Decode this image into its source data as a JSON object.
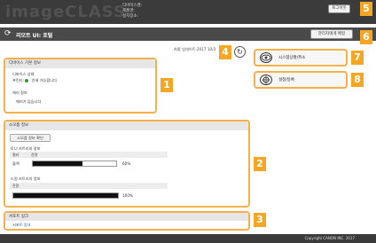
{
  "header": {
    "brand": "imageCLASS",
    "device_name_label": "디바이스명:",
    "product_name_label": "제품명:",
    "location_label": "설치장소:",
    "logout_label": "로그아웃"
  },
  "titlebar": {
    "title": "리모트 UI: 포털",
    "admin_mail_label": "관리자에게 메일"
  },
  "status": {
    "last_updated": "최종 업데이트:2017 10/3"
  },
  "device_info": {
    "heading": "디바이스 기본 정보",
    "state_label": "디바이스 상태",
    "printer_label": "프린터:",
    "printer_status": "인쇄 가능합니다",
    "error_heading": "에러 정보",
    "error_text": "에러가 없습니다"
  },
  "consumables": {
    "heading": "소모품 정보",
    "check_button": "소모품 정보 확인",
    "toner_heading": "토너 카트리지 정보",
    "toner_col_color": "컬러",
    "toner_col_level": "잔량",
    "toner_color": "블랙",
    "toner_percent": "60%",
    "toner_level": 0.6,
    "drum_heading": "드럼 카트리지 정보",
    "drum_col_level": "잔량",
    "drum_percent": "100%",
    "drum_level": 1.0
  },
  "support": {
    "heading": "서포트 링크",
    "link": "서포트 링크"
  },
  "side": {
    "status_monitor_label": "시스템상황/취소",
    "settings_label": "설정/등록"
  },
  "callouts": [
    "1",
    "2",
    "3",
    "4",
    "5",
    "6",
    "7",
    "8"
  ],
  "footer": {
    "copyright": "Copyright CANON INC. 2017"
  },
  "colors": {
    "accent": "#f5a623",
    "header_bg": "#3b3b3b",
    "ok": "#2e9c3a"
  }
}
